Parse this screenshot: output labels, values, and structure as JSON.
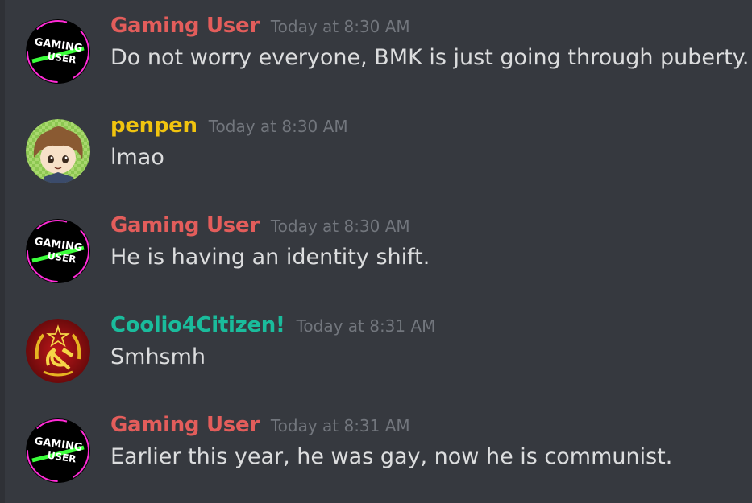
{
  "colors": {
    "background": "#36393f",
    "text": "#dcddde",
    "timestamp": "#72767d",
    "gaming_user": "#e35d5b",
    "penpen": "#f1c40f",
    "coolio": "#1abc9c"
  },
  "messages": [
    {
      "username": "Gaming User",
      "timestamp": "Today at 8:30 AM",
      "text": "Do not worry everyone, BMK is just going through puberty.",
      "avatar": "gaming-user-avatar",
      "avatar_text_line1": "GAMING",
      "avatar_text_line2": "USER"
    },
    {
      "username": "penpen",
      "timestamp": "Today at 8:30 AM",
      "text": "lmao",
      "avatar": "anime-boy-avatar"
    },
    {
      "username": "Gaming User",
      "timestamp": "Today at 8:30 AM",
      "text": "He is having an identity shift.",
      "avatar": "gaming-user-avatar",
      "avatar_text_line1": "GAMING",
      "avatar_text_line2": "USER"
    },
    {
      "username": "Coolio4Citizen!",
      "timestamp": "Today at 8:31 AM",
      "text": "Smhsmh",
      "avatar": "hammer-sickle-avatar"
    },
    {
      "username": "Gaming User",
      "timestamp": "Today at 8:31 AM",
      "text": "Earlier this year, he was gay, now he is communist.",
      "avatar": "gaming-user-avatar",
      "avatar_text_line1": "GAMING",
      "avatar_text_line2": "USER"
    }
  ]
}
